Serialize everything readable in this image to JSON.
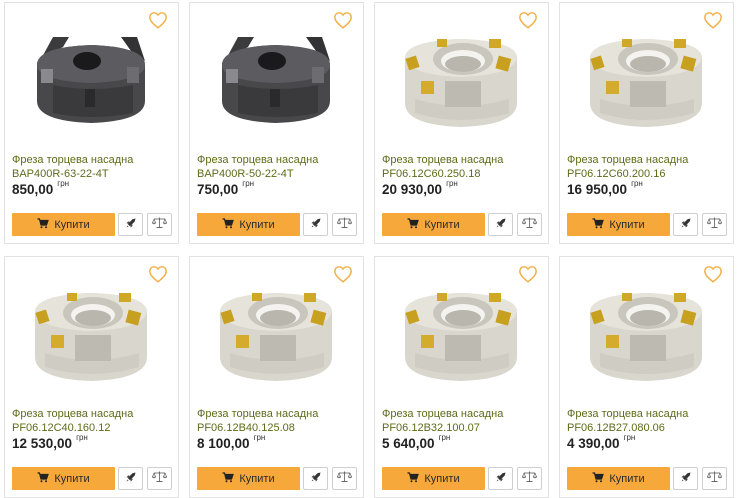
{
  "currency": "грн",
  "buy_label": "Купити",
  "colors": {
    "accent": "#f6a83b",
    "title": "#5d6b1a",
    "heart": "#f0b14a"
  },
  "products": [
    {
      "name_line1": "Фреза торцева насадна",
      "name_line2": "BAP400R-63-22-4T",
      "price": "850,00",
      "image": "dark-face-mill-cutter"
    },
    {
      "name_line1": "Фреза торцева насадна",
      "name_line2": "BAP400R-50-22-4T",
      "price": "750,00",
      "image": "dark-face-mill-cutter"
    },
    {
      "name_line1": "Фреза торцева насадна",
      "name_line2": "PF06.12C60.250.18",
      "price": "20 930,00",
      "image": "silver-face-mill-cutter"
    },
    {
      "name_line1": "Фреза торцева насадна",
      "name_line2": "PF06.12C60.200.16",
      "price": "16 950,00",
      "image": "silver-face-mill-cutter"
    },
    {
      "name_line1": "Фреза торцева насадна",
      "name_line2": "PF06.12C40.160.12",
      "price": "12 530,00",
      "image": "silver-face-mill-cutter"
    },
    {
      "name_line1": "Фреза торцева насадна",
      "name_line2": "PF06.12B40.125.08",
      "price": "8 100,00",
      "image": "silver-face-mill-cutter"
    },
    {
      "name_line1": "Фреза торцева насадна",
      "name_line2": "PF06.12B32.100.07",
      "price": "5 640,00",
      "image": "silver-face-mill-cutter"
    },
    {
      "name_line1": "Фреза торцева насадна",
      "name_line2": "PF06.12B27.080.06",
      "price": "4 390,00",
      "image": "silver-face-mill-cutter"
    }
  ]
}
